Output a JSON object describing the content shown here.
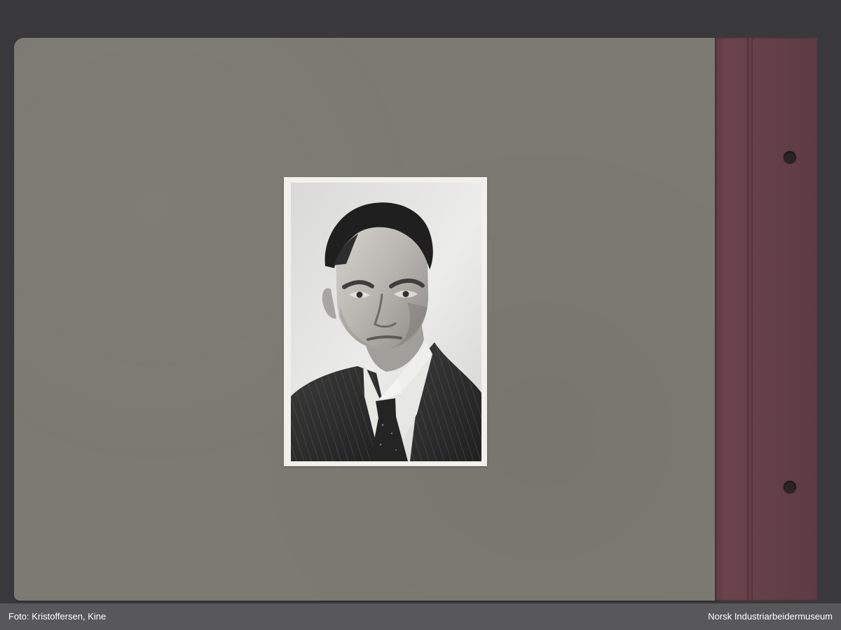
{
  "footer": {
    "credit": "Foto: Kristoffersen, Kine",
    "museum": "Norsk Industriarbeidermuseum"
  },
  "photo": {
    "subject": "black-and-white portrait of an older man in a pinstripe suit and tie"
  },
  "colors": {
    "album_page": "#7b7a73",
    "binding": "#654049",
    "footer": "#58585a"
  }
}
